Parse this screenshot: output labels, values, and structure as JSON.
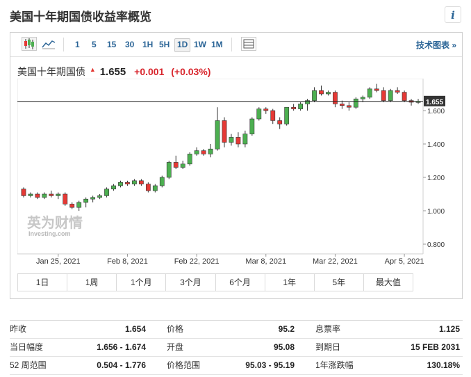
{
  "page": {
    "title": "美国十年期国债收益率概览",
    "info_icon": "i"
  },
  "toolbar": {
    "chart_type_icons": [
      "candlestick-icon",
      "area-chart-icon"
    ],
    "timeframes": [
      "1",
      "5",
      "15",
      "30",
      "1H",
      "5H",
      "1D",
      "1W",
      "1M"
    ],
    "active_timeframe": "1D",
    "table_icon": "table-icon",
    "tech_chart_label": "技术图表 »"
  },
  "quote": {
    "name": "美国十年期国债",
    "price": "1.655",
    "change": "+0.001",
    "change_pct": "(+0.03%)",
    "up_color": "#d8262d"
  },
  "watermark": {
    "brand": "英为财情",
    "sub": "Investing.com"
  },
  "range_buttons": [
    "1日",
    "1周",
    "1个月",
    "3个月",
    "6个月",
    "1年",
    "5年",
    "最大值"
  ],
  "stats": [
    [
      {
        "label": "昨收",
        "value": "1.654"
      },
      {
        "label": "价格",
        "value": "95.2"
      },
      {
        "label": "息票率",
        "value": "1.125"
      }
    ],
    [
      {
        "label": "当日幅度",
        "value": "1.656 - 1.674"
      },
      {
        "label": "开盘",
        "value": "95.08"
      },
      {
        "label": "到期日",
        "value": "15 FEB 2031"
      }
    ],
    [
      {
        "label": "52 周范围",
        "value": "0.504 - 1.776"
      },
      {
        "label": "价格范围",
        "value": "95.03 - 95.19"
      },
      {
        "label": "1年涨跌幅",
        "value": "130.18%"
      }
    ]
  ],
  "chart_data": {
    "type": "candlestick",
    "colors": {
      "up": "#4caf50",
      "down": "#e53935",
      "last_price_line": "#222222",
      "last_price_label_bg": "#333333"
    },
    "ylim": [
      0.8,
      1.75
    ],
    "y_ticks": [
      "0.800",
      "1.000",
      "1.200",
      "1.400",
      "1.600"
    ],
    "x_ticks": [
      {
        "label": "Jan 25, 2021",
        "index": 5
      },
      {
        "label": "Feb 8, 2021",
        "index": 15
      },
      {
        "label": "Feb 22, 2021",
        "index": 25
      },
      {
        "label": "Mar 8, 2021",
        "index": 35
      },
      {
        "label": "Mar 22, 2021",
        "index": 45
      },
      {
        "label": "Apr 5, 2021",
        "index": 55
      }
    ],
    "last_price": "1.655",
    "candles": [
      {
        "o": 1.13,
        "h": 1.14,
        "l": 1.08,
        "c": 1.09
      },
      {
        "o": 1.09,
        "h": 1.11,
        "l": 1.08,
        "c": 1.1
      },
      {
        "o": 1.1,
        "h": 1.11,
        "l": 1.07,
        "c": 1.08
      },
      {
        "o": 1.08,
        "h": 1.11,
        "l": 1.07,
        "c": 1.1
      },
      {
        "o": 1.1,
        "h": 1.12,
        "l": 1.08,
        "c": 1.09
      },
      {
        "o": 1.09,
        "h": 1.11,
        "l": 1.07,
        "c": 1.1
      },
      {
        "o": 1.1,
        "h": 1.11,
        "l": 1.03,
        "c": 1.04
      },
      {
        "o": 1.04,
        "h": 1.05,
        "l": 1.01,
        "c": 1.02
      },
      {
        "o": 1.02,
        "h": 1.06,
        "l": 1.0,
        "c": 1.05
      },
      {
        "o": 1.05,
        "h": 1.08,
        "l": 1.02,
        "c": 1.07
      },
      {
        "o": 1.07,
        "h": 1.09,
        "l": 1.05,
        "c": 1.08
      },
      {
        "o": 1.08,
        "h": 1.1,
        "l": 1.07,
        "c": 1.09
      },
      {
        "o": 1.09,
        "h": 1.14,
        "l": 1.08,
        "c": 1.13
      },
      {
        "o": 1.13,
        "h": 1.16,
        "l": 1.12,
        "c": 1.15
      },
      {
        "o": 1.15,
        "h": 1.18,
        "l": 1.14,
        "c": 1.17
      },
      {
        "o": 1.17,
        "h": 1.18,
        "l": 1.15,
        "c": 1.16
      },
      {
        "o": 1.16,
        "h": 1.19,
        "l": 1.15,
        "c": 1.18
      },
      {
        "o": 1.18,
        "h": 1.19,
        "l": 1.15,
        "c": 1.16
      },
      {
        "o": 1.16,
        "h": 1.17,
        "l": 1.11,
        "c": 1.12
      },
      {
        "o": 1.12,
        "h": 1.16,
        "l": 1.11,
        "c": 1.15
      },
      {
        "o": 1.15,
        "h": 1.21,
        "l": 1.14,
        "c": 1.2
      },
      {
        "o": 1.2,
        "h": 1.3,
        "l": 1.19,
        "c": 1.29
      },
      {
        "o": 1.29,
        "h": 1.33,
        "l": 1.25,
        "c": 1.26
      },
      {
        "o": 1.26,
        "h": 1.3,
        "l": 1.25,
        "c": 1.28
      },
      {
        "o": 1.28,
        "h": 1.35,
        "l": 1.27,
        "c": 1.34
      },
      {
        "o": 1.34,
        "h": 1.38,
        "l": 1.33,
        "c": 1.36
      },
      {
        "o": 1.36,
        "h": 1.37,
        "l": 1.33,
        "c": 1.34
      },
      {
        "o": 1.34,
        "h": 1.4,
        "l": 1.32,
        "c": 1.37
      },
      {
        "o": 1.37,
        "h": 1.62,
        "l": 1.36,
        "c": 1.54
      },
      {
        "o": 1.54,
        "h": 1.56,
        "l": 1.38,
        "c": 1.41
      },
      {
        "o": 1.41,
        "h": 1.46,
        "l": 1.39,
        "c": 1.44
      },
      {
        "o": 1.44,
        "h": 1.47,
        "l": 1.38,
        "c": 1.4
      },
      {
        "o": 1.4,
        "h": 1.48,
        "l": 1.38,
        "c": 1.46
      },
      {
        "o": 1.46,
        "h": 1.56,
        "l": 1.45,
        "c": 1.55
      },
      {
        "o": 1.55,
        "h": 1.62,
        "l": 1.54,
        "c": 1.61
      },
      {
        "o": 1.61,
        "h": 1.62,
        "l": 1.58,
        "c": 1.6
      },
      {
        "o": 1.6,
        "h": 1.61,
        "l": 1.52,
        "c": 1.54
      },
      {
        "o": 1.54,
        "h": 1.56,
        "l": 1.49,
        "c": 1.52
      },
      {
        "o": 1.52,
        "h": 1.62,
        "l": 1.51,
        "c": 1.62
      },
      {
        "o": 1.62,
        "h": 1.64,
        "l": 1.6,
        "c": 1.61
      },
      {
        "o": 1.61,
        "h": 1.65,
        "l": 1.6,
        "c": 1.64
      },
      {
        "o": 1.64,
        "h": 1.67,
        "l": 1.6,
        "c": 1.66
      },
      {
        "o": 1.66,
        "h": 1.74,
        "l": 1.65,
        "c": 1.72
      },
      {
        "o": 1.72,
        "h": 1.75,
        "l": 1.69,
        "c": 1.7
      },
      {
        "o": 1.7,
        "h": 1.72,
        "l": 1.69,
        "c": 1.71
      },
      {
        "o": 1.71,
        "h": 1.72,
        "l": 1.62,
        "c": 1.64
      },
      {
        "o": 1.64,
        "h": 1.66,
        "l": 1.61,
        "c": 1.63
      },
      {
        "o": 1.63,
        "h": 1.65,
        "l": 1.6,
        "c": 1.62
      },
      {
        "o": 1.62,
        "h": 1.68,
        "l": 1.61,
        "c": 1.67
      },
      {
        "o": 1.67,
        "h": 1.69,
        "l": 1.65,
        "c": 1.68
      },
      {
        "o": 1.68,
        "h": 1.74,
        "l": 1.67,
        "c": 1.73
      },
      {
        "o": 1.73,
        "h": 1.76,
        "l": 1.71,
        "c": 1.72
      },
      {
        "o": 1.72,
        "h": 1.74,
        "l": 1.65,
        "c": 1.66
      },
      {
        "o": 1.66,
        "h": 1.73,
        "l": 1.65,
        "c": 1.72
      },
      {
        "o": 1.72,
        "h": 1.74,
        "l": 1.7,
        "c": 1.71
      },
      {
        "o": 1.71,
        "h": 1.72,
        "l": 1.65,
        "c": 1.66
      },
      {
        "o": 1.66,
        "h": 1.67,
        "l": 1.63,
        "c": 1.65
      },
      {
        "o": 1.65,
        "h": 1.67,
        "l": 1.64,
        "c": 1.655
      }
    ]
  }
}
